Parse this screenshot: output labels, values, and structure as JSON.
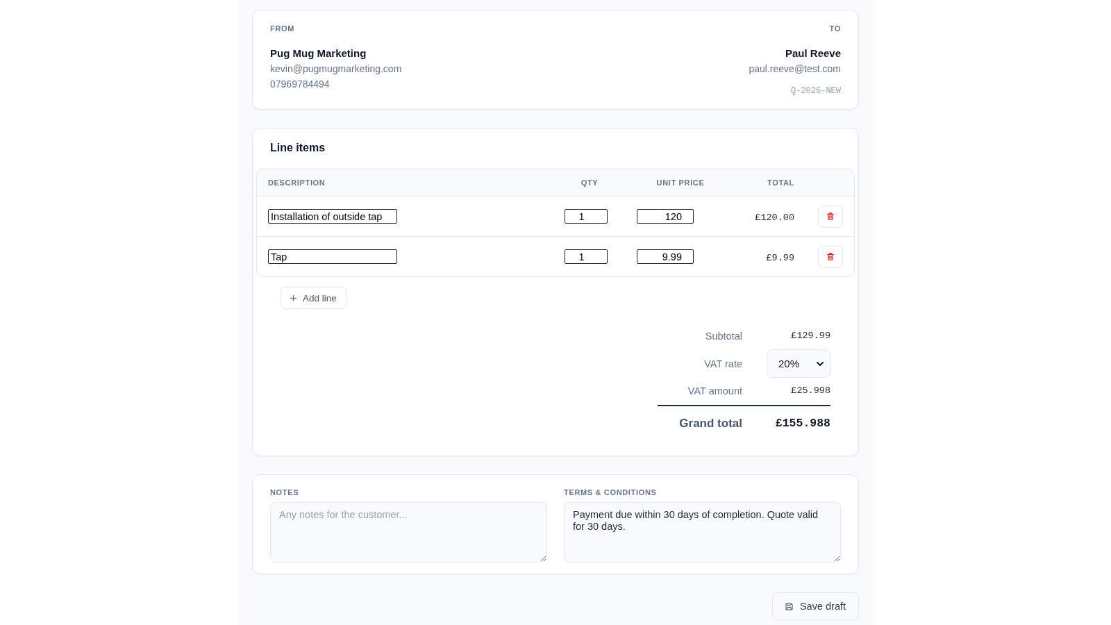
{
  "parties": {
    "from": {
      "label": "FROM",
      "name": "Pug Mug Marketing",
      "email": "kevin@pugmugmarketing.com",
      "phone": "07969784494"
    },
    "to": {
      "label": "TO",
      "name": "Paul Reeve",
      "email": "paul.reeve@test.com",
      "reference": "Q-2026-NEW"
    }
  },
  "line_items": {
    "title": "Line items",
    "columns": [
      "DESCRIPTION",
      "QTY",
      "UNIT PRICE",
      "TOTAL"
    ],
    "rows": [
      {
        "description": "Installation of outside tap",
        "qty": "1",
        "unit_price": "120",
        "total": "£120.00"
      },
      {
        "description": "Tap",
        "qty": "1",
        "unit_price": "9.99",
        "total": "£9.99"
      }
    ],
    "add_button": "Add line",
    "summary": [
      {
        "kind": "amount",
        "label": "Subtotal",
        "value": "£129.99"
      },
      {
        "kind": "select",
        "label": "VAT rate",
        "value": "20%"
      },
      {
        "kind": "amount",
        "label": "VAT amount",
        "value": "£25.998"
      },
      {
        "kind": "grand_total",
        "label": "Grand total",
        "value": "£155.988"
      }
    ]
  },
  "notes": {
    "label": "NOTES",
    "placeholder": "Any notes for the customer..."
  },
  "terms": {
    "label": "TERMS & CONDITIONS",
    "value": "Payment due within 30 days of completion. Quote valid for 30 days."
  },
  "save_button": "Save draft"
}
